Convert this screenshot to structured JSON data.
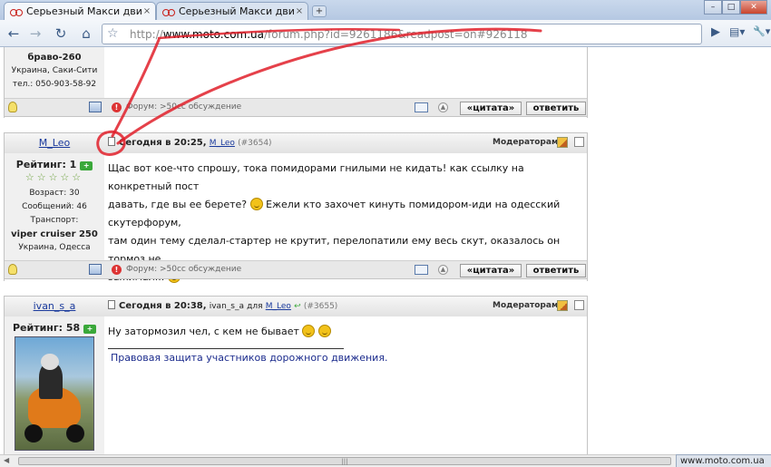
{
  "browser": {
    "tabs": [
      {
        "title": "Серьезный Макси движ!...",
        "close": "×"
      },
      {
        "title": "Серьезный Макси движ!...",
        "close": "×"
      }
    ],
    "new_tab": "+",
    "window_buttons": {
      "minimize": "–",
      "maximize": "□",
      "close": "✕"
    },
    "nav": {
      "back": "←",
      "forward": "→",
      "reload": "↻",
      "home": "⌂",
      "go": "▶",
      "page_menu": "▤▾",
      "tools_menu": "🔧▾"
    },
    "address": {
      "prefix": "http://",
      "host": "www.moto.com.ua",
      "path": "/forum.php?id=9261186&readpost=on#926118"
    },
    "status_text": "www.moto.com.ua"
  },
  "posts": [
    {
      "id": "post-prev",
      "user_lines": [
        "браво-260",
        "Украина, Саки-Сити",
        "тел.: 050-903-58-92"
      ],
      "footer": {
        "forum": "Форум: >50cc обсуждение",
        "quote": "«цитата»",
        "reply": "ответить"
      }
    },
    {
      "id": "post-3654",
      "username": "M_Leo",
      "date": "Сегодня в 20:25,",
      "author": "M_Leo",
      "number": "(#3654)",
      "moderators": "Модераторам:",
      "rating_label": "Рейтинг: 1",
      "stars": "☆☆☆☆☆",
      "age": "Возраст: 30",
      "messages": "Сообщений: 46",
      "transport_label": "Транспорт:",
      "transport": "viper cruiser 250",
      "location": "Украина, Одесса",
      "text": [
        "Щас вот кое-что спрошу, тока помидорами гнилыми не кидать! как ссылку на конкретный пост",
        "давать, где вы ее берете?",
        "Ежели кто захочет кинуть помидором-иди на одесский скутерфорум,",
        "там один тему сделал-стартер не крутит, перелопатили ему весь скут, оказалось он тормоз не",
        "зажимал..."
      ],
      "footer": {
        "forum": "Форум: >50cc обсуждение",
        "quote": "«цитата»",
        "reply": "ответить"
      }
    },
    {
      "id": "post-3655",
      "username": "ivan_s_a",
      "date": "Сегодня в 20:38,",
      "author": "ivan_s_a",
      "to": "для",
      "recipient": "M_Leo",
      "number": "(#3655)",
      "moderators": "Модераторам:",
      "rating_label": "Рейтинг: 58",
      "text": [
        "Ну затормозил чел, с кем не бывает"
      ],
      "signature": "Правовая защита участников дорожного движения."
    }
  ],
  "annotation_color": "#e0202a"
}
